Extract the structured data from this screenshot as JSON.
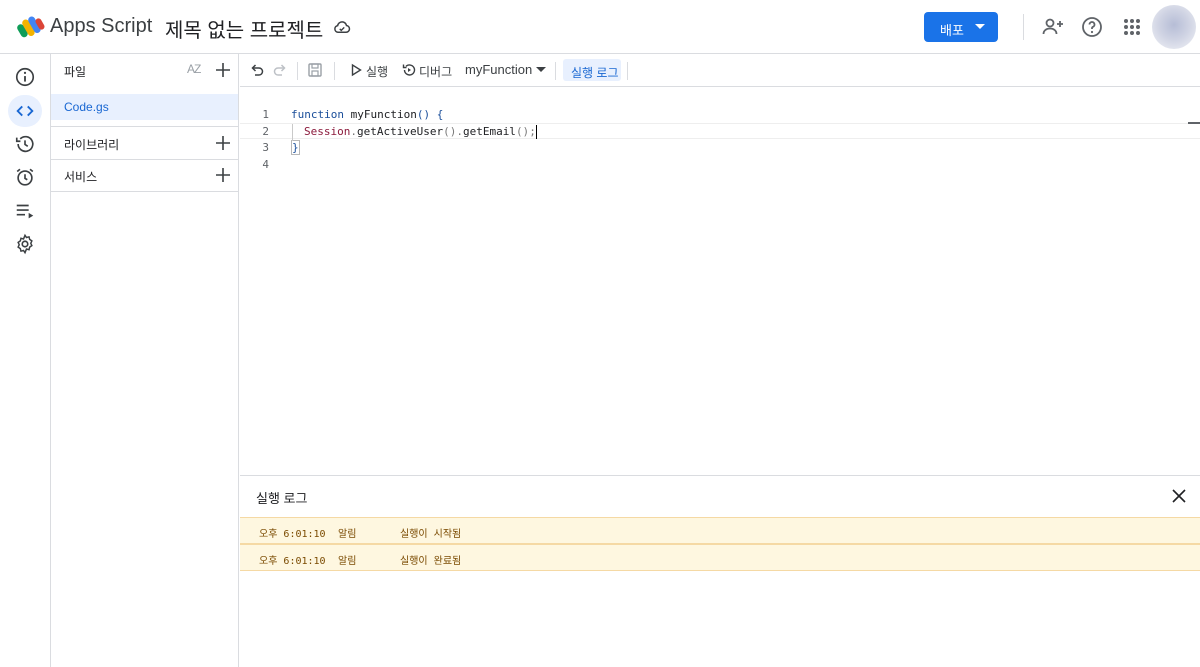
{
  "header": {
    "app_name": "Apps Script",
    "project_title": "제목 없는 프로젝트",
    "deploy_label": "배포",
    "brand_color": "#1a73e8",
    "icons": [
      "apps-script-logo",
      "cloud-saved-icon",
      "add-person-icon",
      "help-icon",
      "apps-grid-icon",
      "avatar"
    ]
  },
  "rail": {
    "icons": [
      "info-icon",
      "code-icon",
      "history-icon",
      "alarm-icon",
      "playlist-icon",
      "settings-icon"
    ],
    "active": "code-icon"
  },
  "sidebar": {
    "files_label": "파일",
    "sort_label": "AZ",
    "files": [
      {
        "name": "Code.gs",
        "selected": true
      }
    ],
    "libraries_label": "라이브러리",
    "services_label": "서비스"
  },
  "toolbar": {
    "run_label": "실행",
    "debug_label": "디버그",
    "function_select": "myFunction",
    "log_label": "실행 로그"
  },
  "editor": {
    "lines": [
      {
        "num": "1"
      },
      {
        "num": "2"
      },
      {
        "num": "3"
      },
      {
        "num": "4"
      }
    ],
    "tokens": {
      "l1_kw": "function",
      "l1_name": "myFunction",
      "l1_paren": "()",
      "l1_brace": "{",
      "l2_obj": "Session",
      "l2_dot1": ".",
      "l2_m1": "getActiveUser",
      "l2_p1": "()",
      "l2_dot2": ".",
      "l2_m2": "getEmail",
      "l2_p2": "()",
      "l2_semi": ";",
      "l3_brace": "}"
    }
  },
  "log_panel": {
    "title": "실행 로그",
    "rows": [
      {
        "time": "오후 6:01:10",
        "level": "알림",
        "message": "실행이 시작됨"
      },
      {
        "time": "오후 6:01:10",
        "level": "알림",
        "message": "실행이 완료됨"
      }
    ]
  }
}
